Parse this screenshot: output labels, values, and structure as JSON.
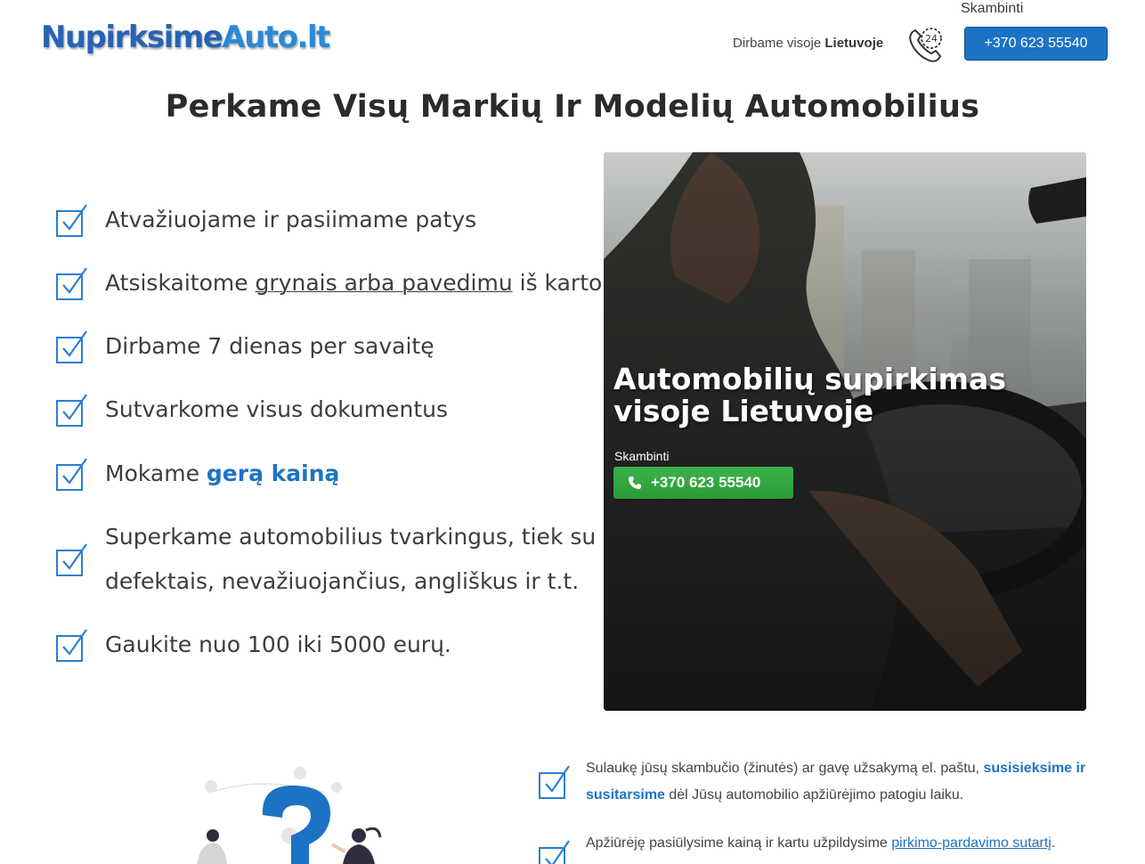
{
  "header": {
    "logo_part1": "Nupirksime",
    "logo_part2": "Auto.lt",
    "note_prefix": "Dirbame visoje",
    "note_bold": "Lietuvoje",
    "call_caption": "Skambinti",
    "phone": "+370 623 55540",
    "icon": "phone-24h-icon"
  },
  "title": "Perkame Visų Markių Ir Modelių Automobilius",
  "features": [
    {
      "text": "Atvažiuojame ir pasiimame patys"
    },
    {
      "pre": "Atsiskaitome ",
      "underlined": "grynais arba pavedimu",
      "post": " iš karto"
    },
    {
      "text": "Dirbame 7 dienas per savaitę"
    },
    {
      "text": "Sutvarkome visus dokumentus"
    },
    {
      "pre": "Mokame ",
      "highlight": "gerą kainą"
    },
    {
      "text": "Superkame automobilius tvarkingus, tiek su defektais, nevažiuojančius, angliškus ir t.t."
    },
    {
      "text": "Gaukite nuo 100 iki 5000 eurų."
    }
  ],
  "hero": {
    "title_line1": "Automobilių supirkimas",
    "title_line2": "visoje Lietuvoje",
    "caption": "Skambinti",
    "phone": "+370 623 55540",
    "icon": "phone-icon"
  },
  "steps": [
    {
      "pre": "Sulaukę jūsų skambučio (žinutės) ar gavę užsakymą el. paštu, ",
      "highlight": "susisieksime ir susitarsime",
      "post": " dėl Jūsų automobilio apžiūrėjimo patogiu laiku."
    },
    {
      "pre": "Apžiūrėję pasiūlysime kainą ir kartu užpildysime ",
      "link": "pirkimo-pardavimo sutartį",
      "post": "."
    }
  ],
  "colors": {
    "brand_blue": "#1c73c4",
    "logo_dark": "#2763b4",
    "green": "#2fa63d"
  }
}
